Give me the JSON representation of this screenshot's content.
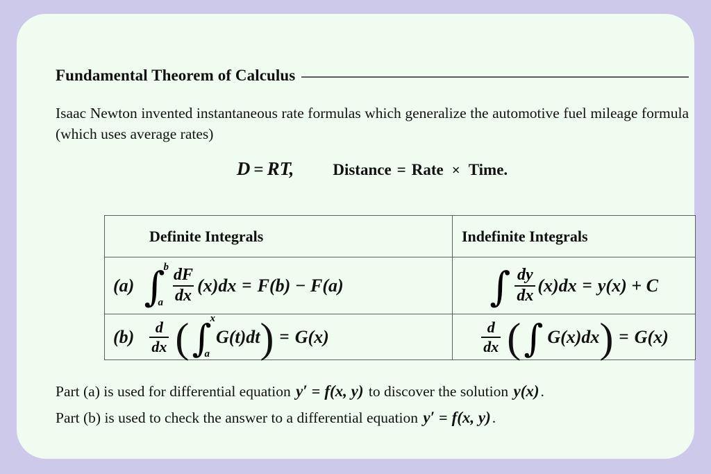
{
  "theme": {
    "page_background": "#ccc9eb",
    "card_background": "#f0fcf0",
    "text_color": "#111111",
    "rule_color": "#5a5a60",
    "table_border_color": "#5d5d62"
  },
  "slide": {
    "title": "Fundamental Theorem of Calculus",
    "intro": "Isaac Newton invented instantaneous rate formulas which generalize the automotive fuel mileage formula (which uses average rates)",
    "display_formula": {
      "symbolic": "D = RT,",
      "symbolic_parts": {
        "d": "D",
        "equals": "=",
        "rt": "RT",
        "comma": ","
      },
      "words": "Distance = Rate × Time.",
      "words_parts": {
        "distance": "Distance",
        "equals": "=",
        "rate": "Rate",
        "times": "×",
        "time": "Time."
      }
    },
    "table": {
      "headers": [
        "Definite Integrals",
        "Indefinite Integrals"
      ],
      "rows": [
        {
          "label": "(a)",
          "definite": {
            "integral_sign": "∫",
            "upper_limit": "b",
            "lower_limit": "a",
            "fraction_numerator": "dF",
            "fraction_denominator": "dx",
            "operand": "(x)dx",
            "equals": "=",
            "result": "F(b) − F(a)",
            "plain": "∫_a^b dF/dx (x)dx = F(b) − F(a)"
          },
          "indefinite": {
            "integral_sign": "∫",
            "fraction_numerator": "dy",
            "fraction_denominator": "dx",
            "operand": "(x)dx",
            "equals": "=",
            "result": "y(x) + C",
            "plain": "∫ dy/dx (x)dx = y(x) + C"
          }
        },
        {
          "label": "(b)",
          "definite": {
            "fraction_numerator": "d",
            "fraction_denominator": "dx",
            "open_paren": "(",
            "integral_sign": "∫",
            "upper_limit": "x",
            "lower_limit": "a",
            "operand": "G(t)dt",
            "close_paren": ")",
            "equals": "=",
            "result": "G(x)",
            "plain": "d/dx ( ∫_a^x G(t)dt ) = G(x)"
          },
          "indefinite": {
            "fraction_numerator": "d",
            "fraction_denominator": "dx",
            "open_paren": "(",
            "integral_sign": "∫",
            "operand": "G(x)dx",
            "close_paren": ")",
            "equals": "=",
            "result": "G(x)",
            "plain": "d/dx ( ∫ G(x)dx ) = G(x)"
          }
        }
      ]
    },
    "notes": [
      {
        "lead": "Part (a) is used for differential equation",
        "math_lhs": "y′",
        "math_equals": "=",
        "math_rhs": "f(x, y)",
        "middle": "to discover the solution",
        "math_tail": "y(x)",
        "end": "."
      },
      {
        "lead": "Part (b) is used to check the answer to a differential equation",
        "math_lhs": "y′",
        "math_equals": "=",
        "math_rhs": "f(x, y)",
        "middle": "",
        "math_tail": "",
        "end": "."
      }
    ]
  }
}
